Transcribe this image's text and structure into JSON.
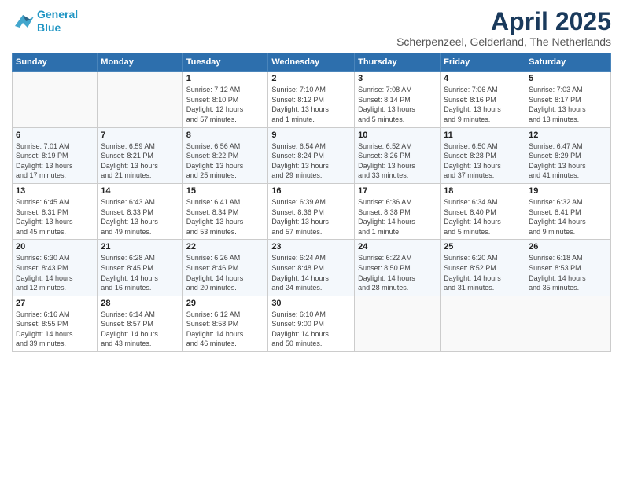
{
  "logo": {
    "line1": "General",
    "line2": "Blue"
  },
  "title": "April 2025",
  "subtitle": "Scherpenzeel, Gelderland, The Netherlands",
  "weekdays": [
    "Sunday",
    "Monday",
    "Tuesday",
    "Wednesday",
    "Thursday",
    "Friday",
    "Saturday"
  ],
  "weeks": [
    [
      {
        "day": "",
        "info": ""
      },
      {
        "day": "",
        "info": ""
      },
      {
        "day": "1",
        "info": "Sunrise: 7:12 AM\nSunset: 8:10 PM\nDaylight: 12 hours\nand 57 minutes."
      },
      {
        "day": "2",
        "info": "Sunrise: 7:10 AM\nSunset: 8:12 PM\nDaylight: 13 hours\nand 1 minute."
      },
      {
        "day": "3",
        "info": "Sunrise: 7:08 AM\nSunset: 8:14 PM\nDaylight: 13 hours\nand 5 minutes."
      },
      {
        "day": "4",
        "info": "Sunrise: 7:06 AM\nSunset: 8:16 PM\nDaylight: 13 hours\nand 9 minutes."
      },
      {
        "day": "5",
        "info": "Sunrise: 7:03 AM\nSunset: 8:17 PM\nDaylight: 13 hours\nand 13 minutes."
      }
    ],
    [
      {
        "day": "6",
        "info": "Sunrise: 7:01 AM\nSunset: 8:19 PM\nDaylight: 13 hours\nand 17 minutes."
      },
      {
        "day": "7",
        "info": "Sunrise: 6:59 AM\nSunset: 8:21 PM\nDaylight: 13 hours\nand 21 minutes."
      },
      {
        "day": "8",
        "info": "Sunrise: 6:56 AM\nSunset: 8:22 PM\nDaylight: 13 hours\nand 25 minutes."
      },
      {
        "day": "9",
        "info": "Sunrise: 6:54 AM\nSunset: 8:24 PM\nDaylight: 13 hours\nand 29 minutes."
      },
      {
        "day": "10",
        "info": "Sunrise: 6:52 AM\nSunset: 8:26 PM\nDaylight: 13 hours\nand 33 minutes."
      },
      {
        "day": "11",
        "info": "Sunrise: 6:50 AM\nSunset: 8:28 PM\nDaylight: 13 hours\nand 37 minutes."
      },
      {
        "day": "12",
        "info": "Sunrise: 6:47 AM\nSunset: 8:29 PM\nDaylight: 13 hours\nand 41 minutes."
      }
    ],
    [
      {
        "day": "13",
        "info": "Sunrise: 6:45 AM\nSunset: 8:31 PM\nDaylight: 13 hours\nand 45 minutes."
      },
      {
        "day": "14",
        "info": "Sunrise: 6:43 AM\nSunset: 8:33 PM\nDaylight: 13 hours\nand 49 minutes."
      },
      {
        "day": "15",
        "info": "Sunrise: 6:41 AM\nSunset: 8:34 PM\nDaylight: 13 hours\nand 53 minutes."
      },
      {
        "day": "16",
        "info": "Sunrise: 6:39 AM\nSunset: 8:36 PM\nDaylight: 13 hours\nand 57 minutes."
      },
      {
        "day": "17",
        "info": "Sunrise: 6:36 AM\nSunset: 8:38 PM\nDaylight: 14 hours\nand 1 minute."
      },
      {
        "day": "18",
        "info": "Sunrise: 6:34 AM\nSunset: 8:40 PM\nDaylight: 14 hours\nand 5 minutes."
      },
      {
        "day": "19",
        "info": "Sunrise: 6:32 AM\nSunset: 8:41 PM\nDaylight: 14 hours\nand 9 minutes."
      }
    ],
    [
      {
        "day": "20",
        "info": "Sunrise: 6:30 AM\nSunset: 8:43 PM\nDaylight: 14 hours\nand 12 minutes."
      },
      {
        "day": "21",
        "info": "Sunrise: 6:28 AM\nSunset: 8:45 PM\nDaylight: 14 hours\nand 16 minutes."
      },
      {
        "day": "22",
        "info": "Sunrise: 6:26 AM\nSunset: 8:46 PM\nDaylight: 14 hours\nand 20 minutes."
      },
      {
        "day": "23",
        "info": "Sunrise: 6:24 AM\nSunset: 8:48 PM\nDaylight: 14 hours\nand 24 minutes."
      },
      {
        "day": "24",
        "info": "Sunrise: 6:22 AM\nSunset: 8:50 PM\nDaylight: 14 hours\nand 28 minutes."
      },
      {
        "day": "25",
        "info": "Sunrise: 6:20 AM\nSunset: 8:52 PM\nDaylight: 14 hours\nand 31 minutes."
      },
      {
        "day": "26",
        "info": "Sunrise: 6:18 AM\nSunset: 8:53 PM\nDaylight: 14 hours\nand 35 minutes."
      }
    ],
    [
      {
        "day": "27",
        "info": "Sunrise: 6:16 AM\nSunset: 8:55 PM\nDaylight: 14 hours\nand 39 minutes."
      },
      {
        "day": "28",
        "info": "Sunrise: 6:14 AM\nSunset: 8:57 PM\nDaylight: 14 hours\nand 43 minutes."
      },
      {
        "day": "29",
        "info": "Sunrise: 6:12 AM\nSunset: 8:58 PM\nDaylight: 14 hours\nand 46 minutes."
      },
      {
        "day": "30",
        "info": "Sunrise: 6:10 AM\nSunset: 9:00 PM\nDaylight: 14 hours\nand 50 minutes."
      },
      {
        "day": "",
        "info": ""
      },
      {
        "day": "",
        "info": ""
      },
      {
        "day": "",
        "info": ""
      }
    ]
  ]
}
